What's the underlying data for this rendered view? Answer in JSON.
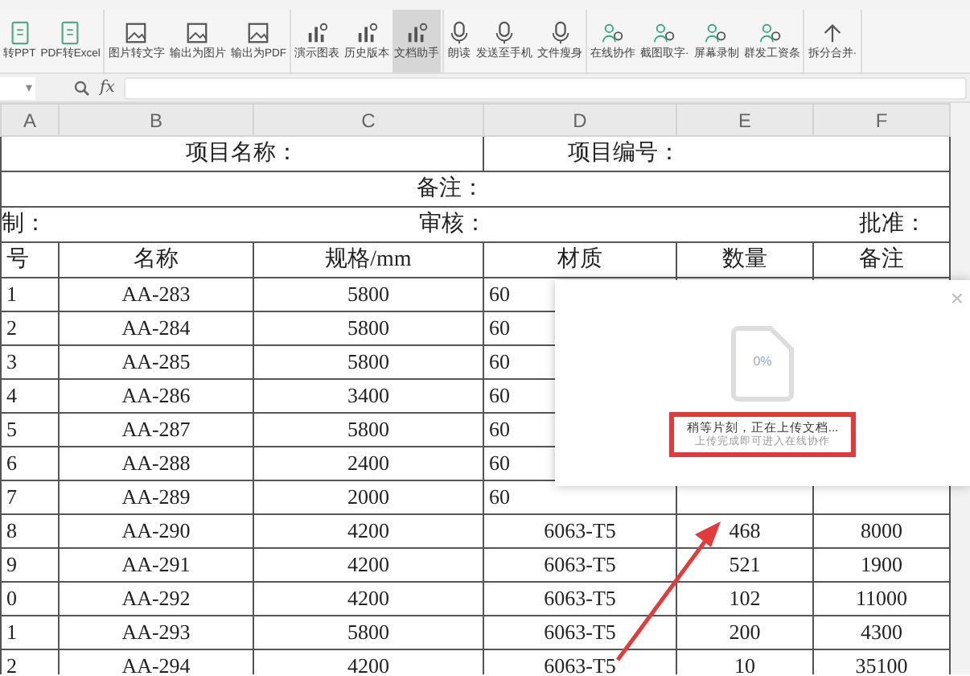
{
  "ribbon": {
    "groups": [
      {
        "items": [
          {
            "label": "转PPT",
            "selected": false
          },
          {
            "label": "PDF转Excel",
            "selected": false
          }
        ]
      },
      {
        "items": [
          {
            "label": "图片转文字",
            "selected": false
          },
          {
            "label": "输出为图片",
            "selected": false
          },
          {
            "label": "输出为PDF",
            "selected": false
          }
        ]
      },
      {
        "items": [
          {
            "label": "演示图表",
            "selected": false
          },
          {
            "label": "历史版本",
            "selected": false
          },
          {
            "label": "文档助手",
            "selected": true
          }
        ]
      },
      {
        "items": [
          {
            "label": "朗读",
            "selected": false
          },
          {
            "label": "发送至手机",
            "selected": false
          },
          {
            "label": "文件瘦身",
            "selected": false
          }
        ]
      },
      {
        "items": [
          {
            "label": "在线协作",
            "selected": false
          },
          {
            "label": "截图取字·",
            "selected": false
          },
          {
            "label": "屏幕录制",
            "selected": false
          },
          {
            "label": "群发工资条",
            "selected": false
          }
        ]
      },
      {
        "items": [
          {
            "label": "拆分合并·",
            "selected": false
          }
        ]
      }
    ]
  },
  "formula_bar": {
    "name_box_caret": "▾",
    "fx": "fx"
  },
  "sheet": {
    "column_headers": [
      "A",
      "B",
      "C",
      "D",
      "E",
      "F"
    ],
    "project_name": "项目名称：",
    "project_number": "项目编号：",
    "remark": "备注：",
    "signatures": [
      "制：",
      "审核：",
      "批准："
    ],
    "table_headers": [
      "号",
      "名称",
      "规格/mm",
      "材质",
      "数量",
      "备注"
    ],
    "rows": [
      [
        "1",
        "AA-283",
        "5800",
        "60",
        "",
        ""
      ],
      [
        "2",
        "AA-284",
        "5800",
        "60",
        "",
        ""
      ],
      [
        "3",
        "AA-285",
        "5800",
        "60",
        "",
        ""
      ],
      [
        "4",
        "AA-286",
        "3400",
        "60",
        "",
        ""
      ],
      [
        "5",
        "AA-287",
        "5800",
        "60",
        "",
        ""
      ],
      [
        "6",
        "AA-288",
        "2400",
        "60",
        "",
        ""
      ],
      [
        "7",
        "AA-289",
        "2000",
        "60",
        "",
        ""
      ],
      [
        "8",
        "AA-290",
        "4200",
        "6063-T5",
        "468",
        "8000"
      ],
      [
        "9",
        "AA-291",
        "4200",
        "6063-T5",
        "521",
        "1900"
      ],
      [
        "0",
        "AA-292",
        "4200",
        "6063-T5",
        "102",
        "11000"
      ],
      [
        "1",
        "AA-293",
        "5800",
        "6063-T5",
        "200",
        "4300"
      ],
      [
        "2",
        "AA-294",
        "4200",
        "6063-T5",
        "10",
        "35100"
      ]
    ]
  },
  "upload_dialog": {
    "close": "×",
    "progress": "0%",
    "message": "稍等片刻，正在上传文档...",
    "hint": "上传完成即可进入在线协作"
  }
}
